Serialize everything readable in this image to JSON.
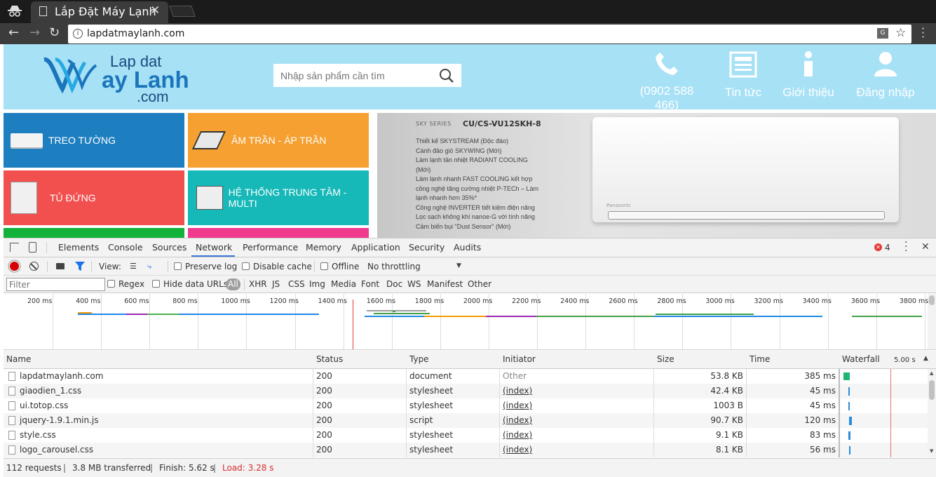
{
  "browser": {
    "tab_title": "Lắp Đặt Máy Lạnh",
    "url": "lapdatmaylanh.com"
  },
  "site": {
    "logo": {
      "line1": "Lap dat",
      "line2": "ay Lanh",
      "line3": ".com"
    },
    "search_placeholder": "Nhập sản phẩm cần tìm",
    "nav": [
      {
        "label": "(0902 588 466)",
        "icon": "phone-icon"
      },
      {
        "label": "Tin tức",
        "icon": "news-icon"
      },
      {
        "label": "Giới thiệu",
        "icon": "info-icon"
      },
      {
        "label": "Đăng nhập",
        "icon": "user-icon"
      }
    ],
    "categories": [
      {
        "label": "TREO TƯỜNG",
        "color": "#1e7fc0"
      },
      {
        "label": "ÂM TRẦN - ÁP TRẦN",
        "color": "#f5a030"
      },
      {
        "label": "TỦ ĐỨNG",
        "color": "#f24f4f"
      },
      {
        "label": "HỆ THỐNG TRUNG TÂM - MULTI",
        "color": "#16b8b8"
      }
    ],
    "banner": {
      "series": "SKY SERIES",
      "model": "CU/CS-VU12SKH-8",
      "features": [
        "Thiết kế SKYSTREAM (Độc đáo)",
        "Cánh đảo gió SKYWING (Mới)",
        "Làm lạnh tản nhiệt RADIANT COOLING",
        "(Mới)",
        "Làm lạnh nhanh FAST COOLING kết hợp",
        "công nghệ tăng cường nhiệt P-TECh – Làm",
        "lạnh nhanh hơn 35%*",
        "Công nghệ INVERTER tiết kiệm điện năng",
        "Lọc sạch không khí nanoe-G với tính năng",
        "Cảm biến bụi \"Dust Sensor\" (Mới)"
      ],
      "brand": "Panasonic"
    }
  },
  "devtools": {
    "tabs": [
      "Elements",
      "Console",
      "Sources",
      "Network",
      "Performance",
      "Memory",
      "Application",
      "Security",
      "Audits"
    ],
    "active_tab": "Network",
    "error_count": "4",
    "toolbar": {
      "view_label": "View:",
      "preserve_log": "Preserve log",
      "disable_cache": "Disable cache",
      "offline": "Offline",
      "throttling": "No throttling"
    },
    "filter": {
      "placeholder": "Filter",
      "regex": "Regex",
      "hide_data_urls": "Hide data URLs",
      "types": [
        "All",
        "XHR",
        "JS",
        "CSS",
        "Img",
        "Media",
        "Font",
        "Doc",
        "WS",
        "Manifest",
        "Other"
      ]
    },
    "overview_ticks": [
      "200 ms",
      "400 ms",
      "600 ms",
      "800 ms",
      "1000 ms",
      "1200 ms",
      "1400 ms",
      "1600 ms",
      "1800 ms",
      "2000 ms",
      "2200 ms",
      "2400 ms",
      "2600 ms",
      "2800 ms",
      "3000 ms",
      "3200 ms",
      "3400 ms",
      "3600 ms",
      "3800 ms"
    ],
    "columns": [
      "Name",
      "Status",
      "Type",
      "Initiator",
      "Size",
      "Time",
      "Waterfall"
    ],
    "waterfall_scale": "5.00 s",
    "requests": [
      {
        "name": "lapdatmaylanh.com",
        "status": "200",
        "type": "document",
        "initiator": "Other",
        "size": "53.8 KB",
        "time": "385 ms"
      },
      {
        "name": "giaodien_1.css",
        "status": "200",
        "type": "stylesheet",
        "initiator": "(index)",
        "size": "42.4 KB",
        "time": "45 ms"
      },
      {
        "name": "ui.totop.css",
        "status": "200",
        "type": "stylesheet",
        "initiator": "(index)",
        "size": "1003 B",
        "time": "45 ms"
      },
      {
        "name": "jquery-1.9.1.min.js",
        "status": "200",
        "type": "script",
        "initiator": "(index)",
        "size": "90.7 KB",
        "time": "120 ms"
      },
      {
        "name": "style.css",
        "status": "200",
        "type": "stylesheet",
        "initiator": "(index)",
        "size": "9.1 KB",
        "time": "83 ms"
      },
      {
        "name": "logo_carousel.css",
        "status": "200",
        "type": "stylesheet",
        "initiator": "(index)",
        "size": "8.1 KB",
        "time": "56 ms"
      }
    ],
    "status_bar": {
      "requests": "112 requests",
      "transferred": "3.8 MB transferred",
      "finish": "Finish: 5.62 s",
      "load": "Load: 3.28 s"
    }
  }
}
